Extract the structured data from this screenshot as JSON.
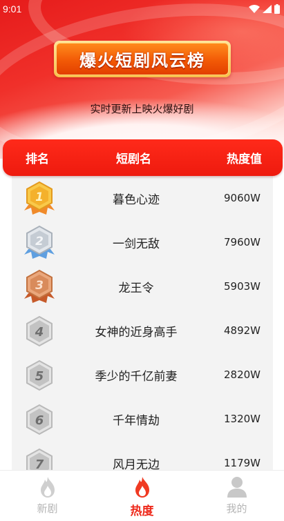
{
  "status_bar": {
    "time": "9:01"
  },
  "banner": {
    "title": "爆火短剧风云榜"
  },
  "subtitle": "实时更新上映火爆好剧",
  "table": {
    "headers": {
      "rank": "排名",
      "name": "短剧名",
      "heat": "热度值"
    },
    "rows": [
      {
        "rank": "1",
        "name": "暮色心迹",
        "heat": "9060W",
        "badge": "gold-medal"
      },
      {
        "rank": "2",
        "name": "一剑无敌",
        "heat": "7960W",
        "badge": "silver-medal"
      },
      {
        "rank": "3",
        "name": "龙王令",
        "heat": "5903W",
        "badge": "bronze-medal"
      },
      {
        "rank": "4",
        "name": "女神的近身高手",
        "heat": "4892W",
        "badge": "gray-hexagon"
      },
      {
        "rank": "5",
        "name": "季少的千亿前妻",
        "heat": "2820W",
        "badge": "gray-hexagon"
      },
      {
        "rank": "6",
        "name": "千年情劫",
        "heat": "1320W",
        "badge": "gray-hexagon"
      },
      {
        "rank": "7",
        "name": "风月无边",
        "heat": "1179W",
        "badge": "gray-hexagon"
      }
    ]
  },
  "tabbar": {
    "tabs": [
      {
        "label": "新剧",
        "icon": "flame-outline-icon",
        "active": false
      },
      {
        "label": "热度",
        "icon": "flame-icon",
        "active": true
      },
      {
        "label": "我的",
        "icon": "user-icon",
        "active": false
      }
    ]
  },
  "colors": {
    "accent": "#ee2a1c",
    "header_red": "#ff2a1a",
    "banner_orange": "#f25a06",
    "gold": "#f5b52e",
    "silver": "#c9d0d8",
    "bronze": "#d88a5a",
    "inactive": "#b5b5b5"
  }
}
